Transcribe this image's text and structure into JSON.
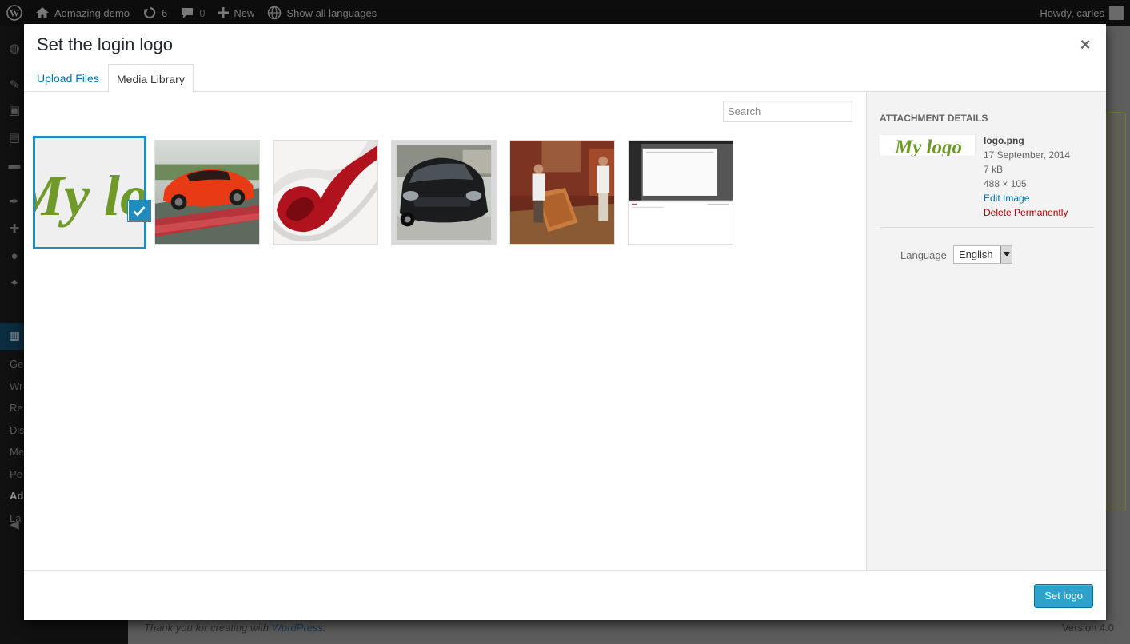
{
  "adminbar": {
    "site_name": "Admazing demo",
    "updates_count": "6",
    "comments_count": "0",
    "new_label": "New",
    "languages_label": "Show all languages",
    "greeting": "Howdy, carles"
  },
  "admin_menu": {
    "submenu_items": [
      "Ge",
      "Wr",
      "Re",
      "Dis",
      "Me",
      "Pe",
      "Ad",
      "La"
    ]
  },
  "background_footer": {
    "thank_you_prefix": "Thank you for creating with ",
    "thank_you_link": "WordPress",
    "thank_you_suffix": ".",
    "version": "Version 4.0"
  },
  "modal": {
    "title": "Set the login logo",
    "close_glyph": "×",
    "tabs": [
      {
        "label": "Upload Files",
        "active": false
      },
      {
        "label": "Media Library",
        "active": true
      }
    ],
    "search_placeholder": "Search",
    "attachments": [
      {
        "name": "logo",
        "selected": true,
        "logo_text": "My logo"
      },
      {
        "name": "red-sports-car",
        "selected": false
      },
      {
        "name": "red-wine-glass",
        "selected": false
      },
      {
        "name": "black-hatchback-car",
        "selected": false
      },
      {
        "name": "carpet-sellers",
        "selected": false
      },
      {
        "name": "admin-screenshot",
        "selected": false
      }
    ],
    "sidebar": {
      "heading": "Attachment Details",
      "filename": "logo.png",
      "date": "17 September, 2014",
      "size": "7 kB",
      "dimensions": "488 × 105",
      "edit_link": "Edit Image",
      "delete_link": "Delete Permanently",
      "language_label": "Language",
      "language_value": "English"
    },
    "primary_button": "Set logo"
  },
  "colors": {
    "accent": "#1e8cbe",
    "logo_green": "#6f9a2a",
    "button_blue": "#2ea2cc",
    "delete_red": "#aa0000",
    "link_blue": "#0073aa"
  }
}
